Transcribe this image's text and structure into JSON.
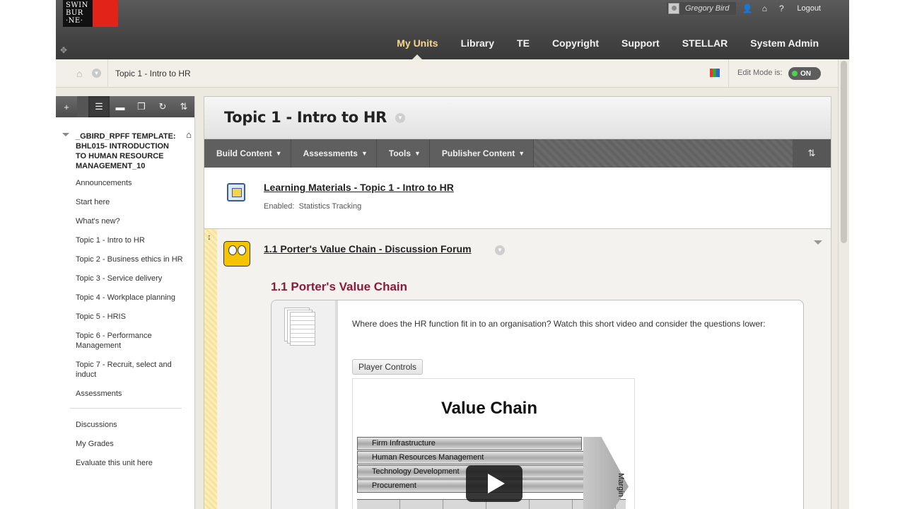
{
  "header": {
    "logo_text": "SWIN BUR NE",
    "user_name": "Gregory Bird",
    "logout_label": "Logout",
    "nav_tabs": [
      "My Units",
      "Library",
      "TE",
      "Copyright",
      "Support",
      "STELLAR",
      "System Admin"
    ],
    "active_tab": "My Units"
  },
  "breadcrumb": {
    "current": "Topic 1 - Intro to HR",
    "edit_mode_label": "Edit Mode is:",
    "edit_mode_state": "ON"
  },
  "sidebar": {
    "course_title": "_GBIRD_RPFF TEMPLATE: BHL015- INTRODUCTION TO HUMAN RESOURCE MANAGEMENT_10",
    "items": [
      "Announcements",
      "Start here",
      "What's new?",
      "Topic 1 - Intro to HR",
      "Topic 2 - Business ethics in HR",
      "Topic 3 - Service delivery",
      "Topic 4 - Workplace planning",
      "Topic 5 - HRIS",
      "Topic 6 - Performance Management",
      "Topic 7 - Recruit, select and induct",
      "Assessments"
    ],
    "tools": [
      "Discussions",
      "My Grades",
      "Evaluate this unit here"
    ]
  },
  "page": {
    "title": "Topic 1 - Intro to HR",
    "action_menus": [
      "Build Content",
      "Assessments",
      "Tools",
      "Publisher Content"
    ]
  },
  "items": {
    "learning_materials": {
      "title": "Learning Materials - Topic 1 - Intro to HR",
      "meta_label": "Enabled:",
      "meta_value": "Statistics Tracking"
    },
    "forum": {
      "title": "1.1 Porter's Value Chain - Discussion Forum",
      "subtitle": "1.1 Porter's Value Chain",
      "description": "Where does the HR function fit in to an organisation?  Watch this short video and consider the questions lower:",
      "player_controls_label": "Player Controls"
    }
  },
  "video": {
    "title": "Value Chain",
    "rows": [
      "Firm Infrastructure",
      "Human Resources Management",
      "Technology Development",
      "Procurement"
    ],
    "margin_label": "Margin"
  },
  "colors": {
    "header_bg": "#454545",
    "active_tab": "#f6d88a",
    "subtitle": "#8b1b3e",
    "toggle_on": "#4fd34f",
    "logo_red": "#e2231a"
  }
}
